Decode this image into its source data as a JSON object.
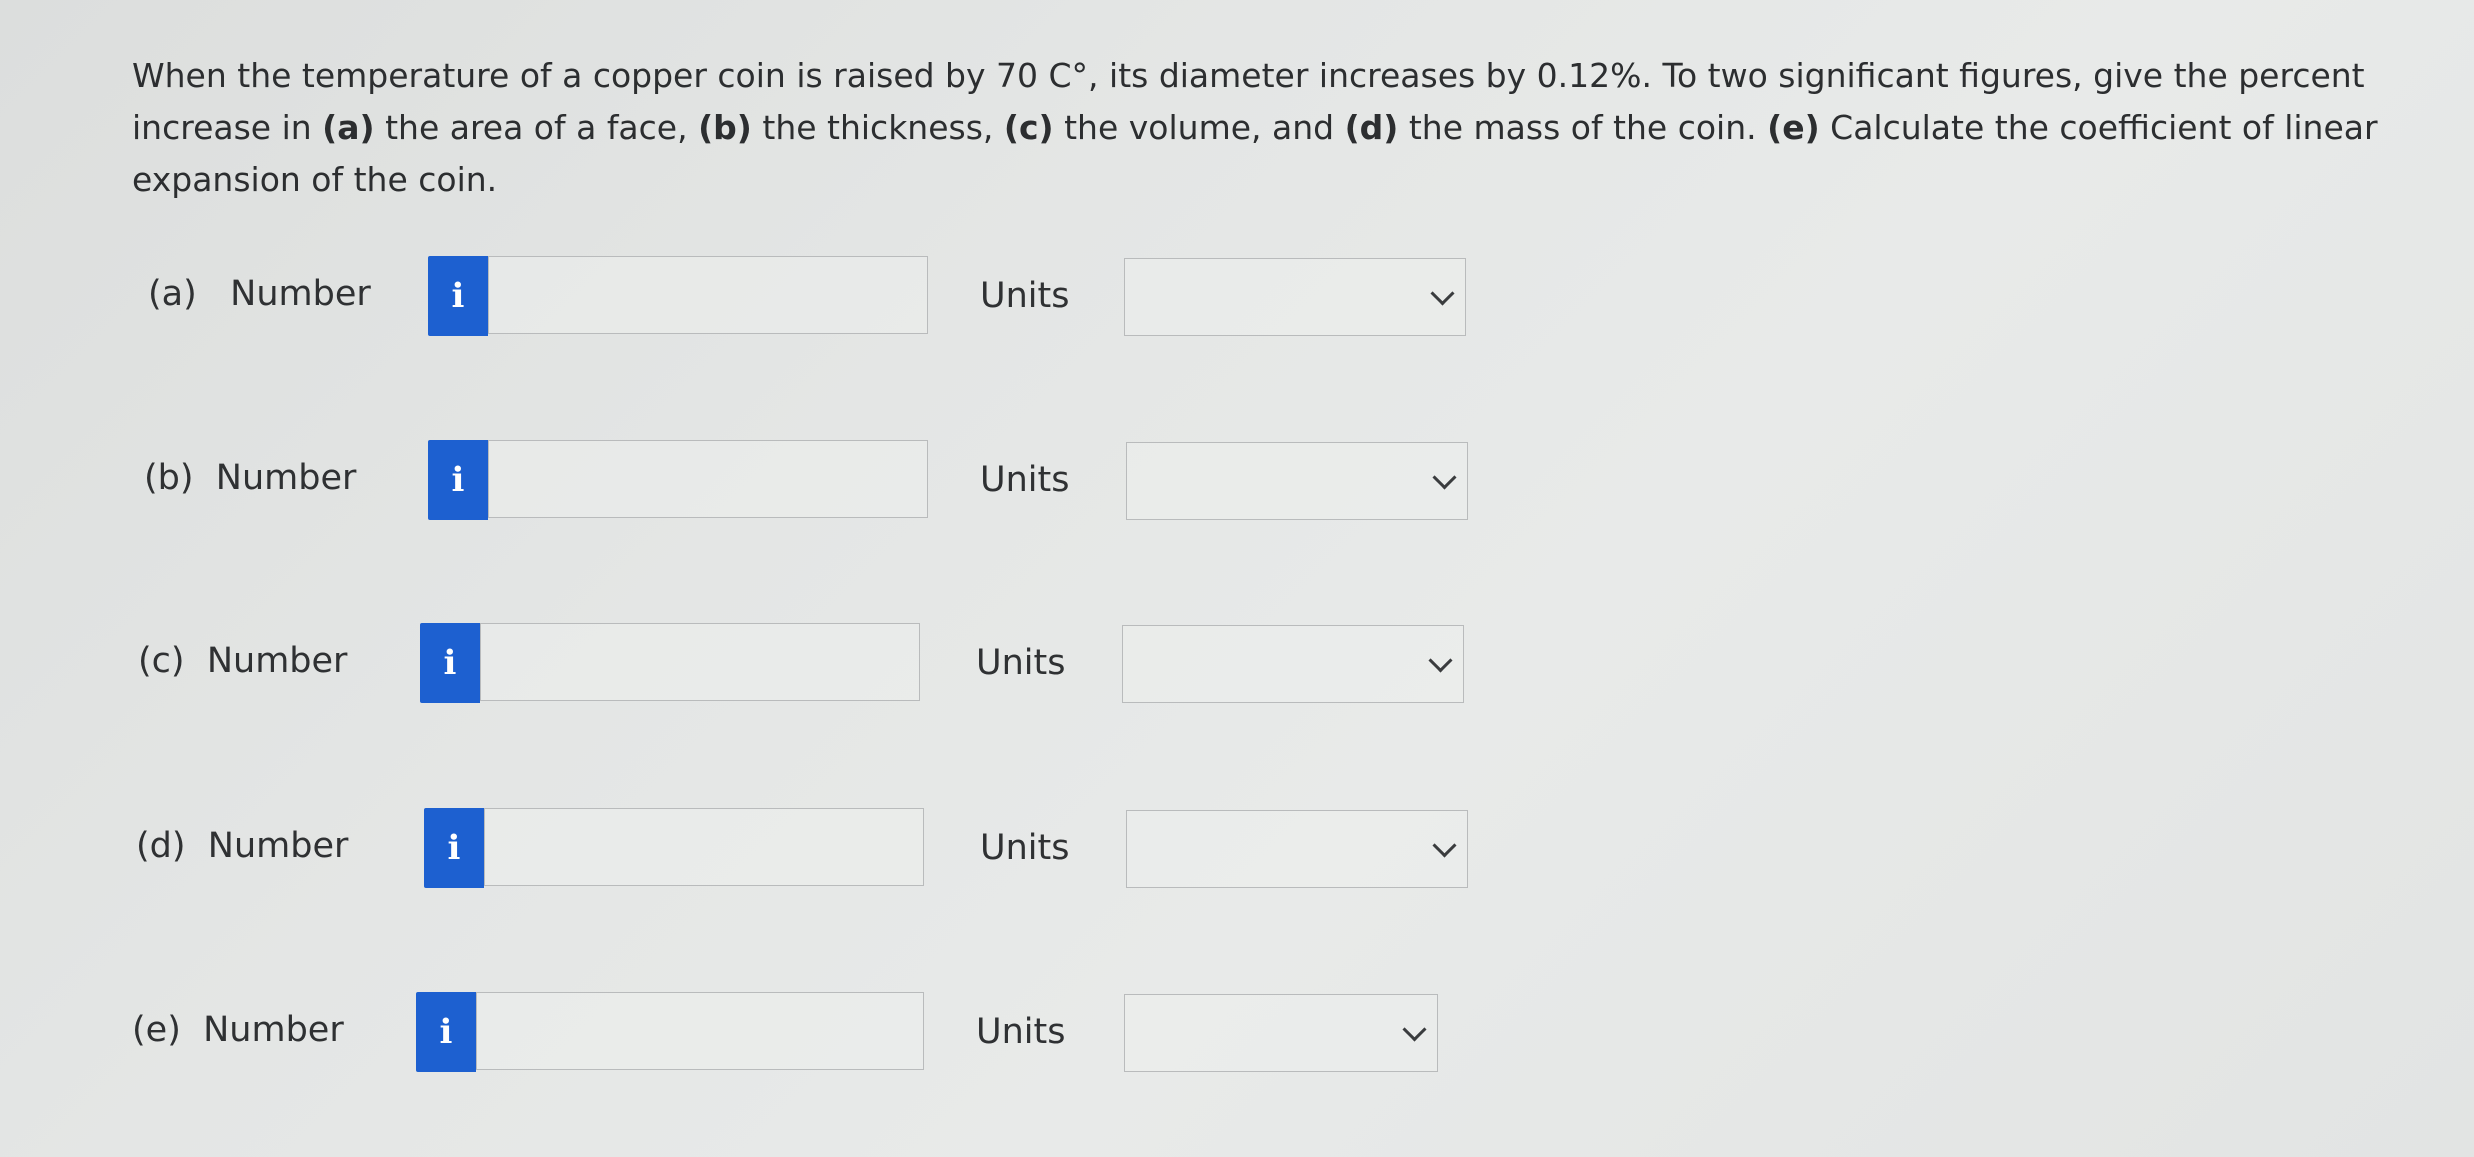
{
  "question": {
    "segments": [
      {
        "text": "When the temperature of a copper coin is raised by 70 C°, its diameter increases by 0.12%. To two significant figures, give the percent increase in ",
        "bold": false
      },
      {
        "text": "(a)",
        "bold": true
      },
      {
        "text": " the area of a face, ",
        "bold": false
      },
      {
        "text": "(b)",
        "bold": true
      },
      {
        "text": " the thickness, ",
        "bold": false
      },
      {
        "text": "(c)",
        "bold": true
      },
      {
        "text": " the volume, and ",
        "bold": false
      },
      {
        "text": "(d)",
        "bold": true
      },
      {
        "text": " the mass of the coin. ",
        "bold": false
      },
      {
        "text": "(e)",
        "bold": true
      },
      {
        "text": " Calculate the coefficient of linear expansion of the coin.",
        "bold": false
      }
    ]
  },
  "parts": [
    {
      "label": "(a)",
      "number_label": "Number",
      "info_icon": "i",
      "value": "",
      "units_label": "Units",
      "units_value": ""
    },
    {
      "label": "(b)",
      "number_label": "Number",
      "info_icon": "i",
      "value": "",
      "units_label": "Units",
      "units_value": ""
    },
    {
      "label": "(c)",
      "number_label": "Number",
      "info_icon": "i",
      "value": "",
      "units_label": "Units",
      "units_value": ""
    },
    {
      "label": "(d)",
      "number_label": "Number",
      "info_icon": "i",
      "value": "",
      "units_label": "Units",
      "units_value": ""
    },
    {
      "label": "(e)",
      "number_label": "Number",
      "info_icon": "i",
      "value": "",
      "units_label": "Units",
      "units_value": ""
    }
  ],
  "colors": {
    "info_button": "#1d60d0",
    "text": "#2f3133",
    "border": "#b9bbbc"
  }
}
